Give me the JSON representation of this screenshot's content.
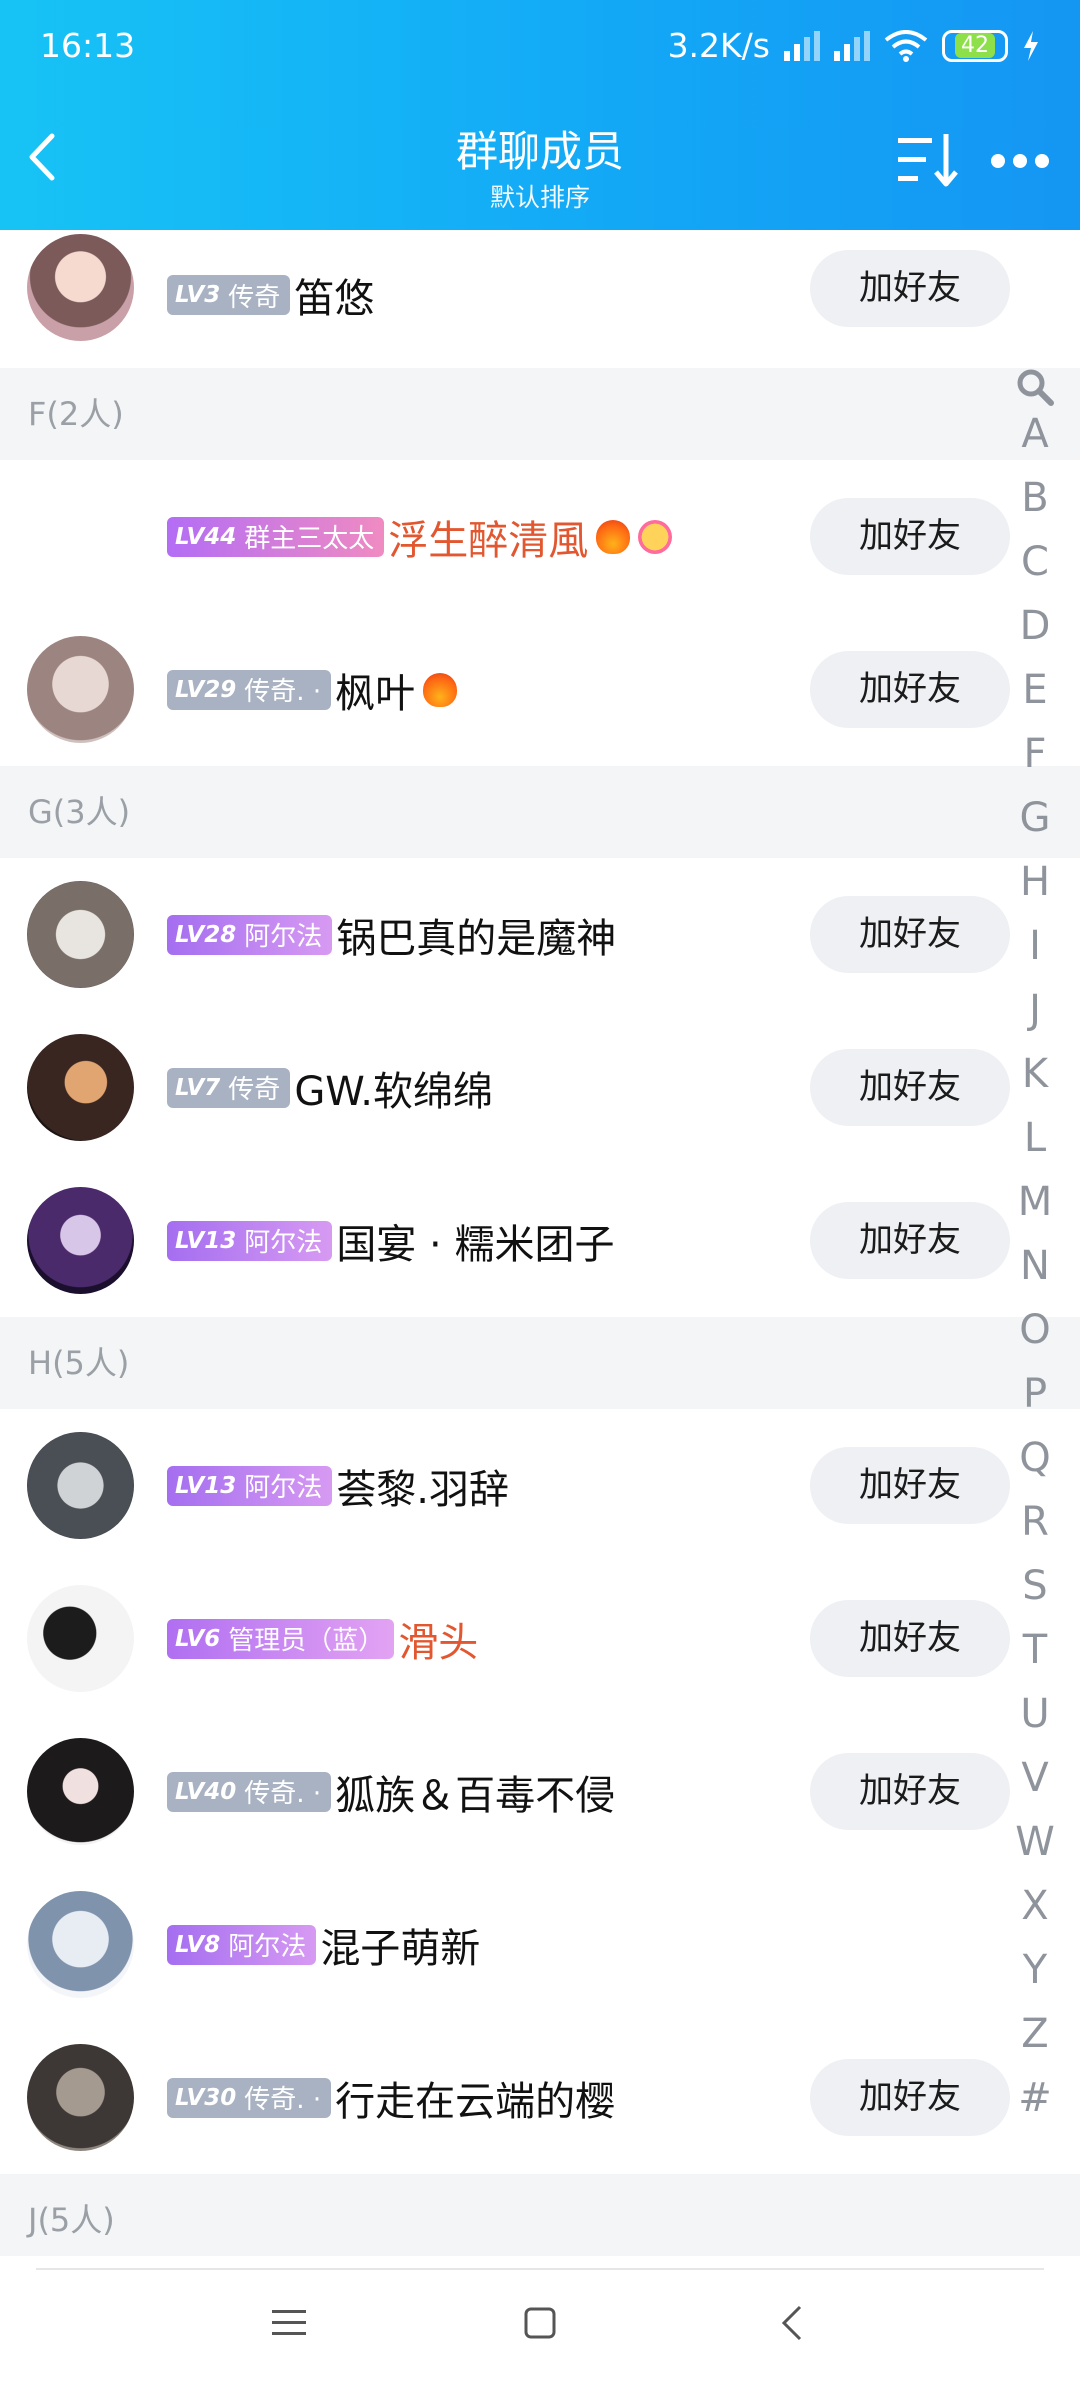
{
  "status_bar": {
    "time": "16:13",
    "speed": "3.2K/s",
    "battery": "42"
  },
  "header": {
    "title": "群聊成员",
    "subtitle": "默认排序"
  },
  "add_label": "加好友",
  "rows_top": [
    {
      "level": "LV3",
      "tag": "传奇",
      "name": "笛悠"
    }
  ],
  "sections": [
    {
      "label": "F(2人)"
    },
    {
      "label": "G(3人)"
    },
    {
      "label": "H(5人)"
    },
    {
      "label": "J(5人)"
    }
  ],
  "rows_f": [
    {
      "level": "LV44",
      "tag": "群主三太太",
      "name": "浮生醉清風"
    },
    {
      "level": "LV29",
      "tag": "传奇. ·",
      "name": "枫叶"
    }
  ],
  "rows_g": [
    {
      "level": "LV28",
      "tag": "阿尔法",
      "name": "锅巴真的是魔神"
    },
    {
      "level": "LV7",
      "tag": "传奇",
      "name": "GW.软绵绵"
    },
    {
      "level": "LV13",
      "tag": "阿尔法",
      "name": "国宴 · 糯米团子"
    }
  ],
  "rows_h": [
    {
      "level": "LV13",
      "tag": "阿尔法",
      "name": "荟黎.羽辞"
    },
    {
      "level": "LV6",
      "tag": "管理员（蓝）",
      "name": "滑头"
    },
    {
      "level": "LV40",
      "tag": "传奇. ·",
      "name": "狐族＆百毒不侵"
    },
    {
      "level": "LV8",
      "tag": "阿尔法",
      "name": "混子萌新"
    },
    {
      "level": "LV30",
      "tag": "传奇. ·",
      "name": "行走在云端的樱"
    }
  ],
  "index_letters": [
    "A",
    "B",
    "C",
    "D",
    "E",
    "F",
    "G",
    "H",
    "I",
    "J",
    "K",
    "L",
    "M",
    "N",
    "O",
    "P",
    "Q",
    "R",
    "S",
    "T",
    "U",
    "V",
    "W",
    "X",
    "Y",
    "Z",
    "#"
  ]
}
